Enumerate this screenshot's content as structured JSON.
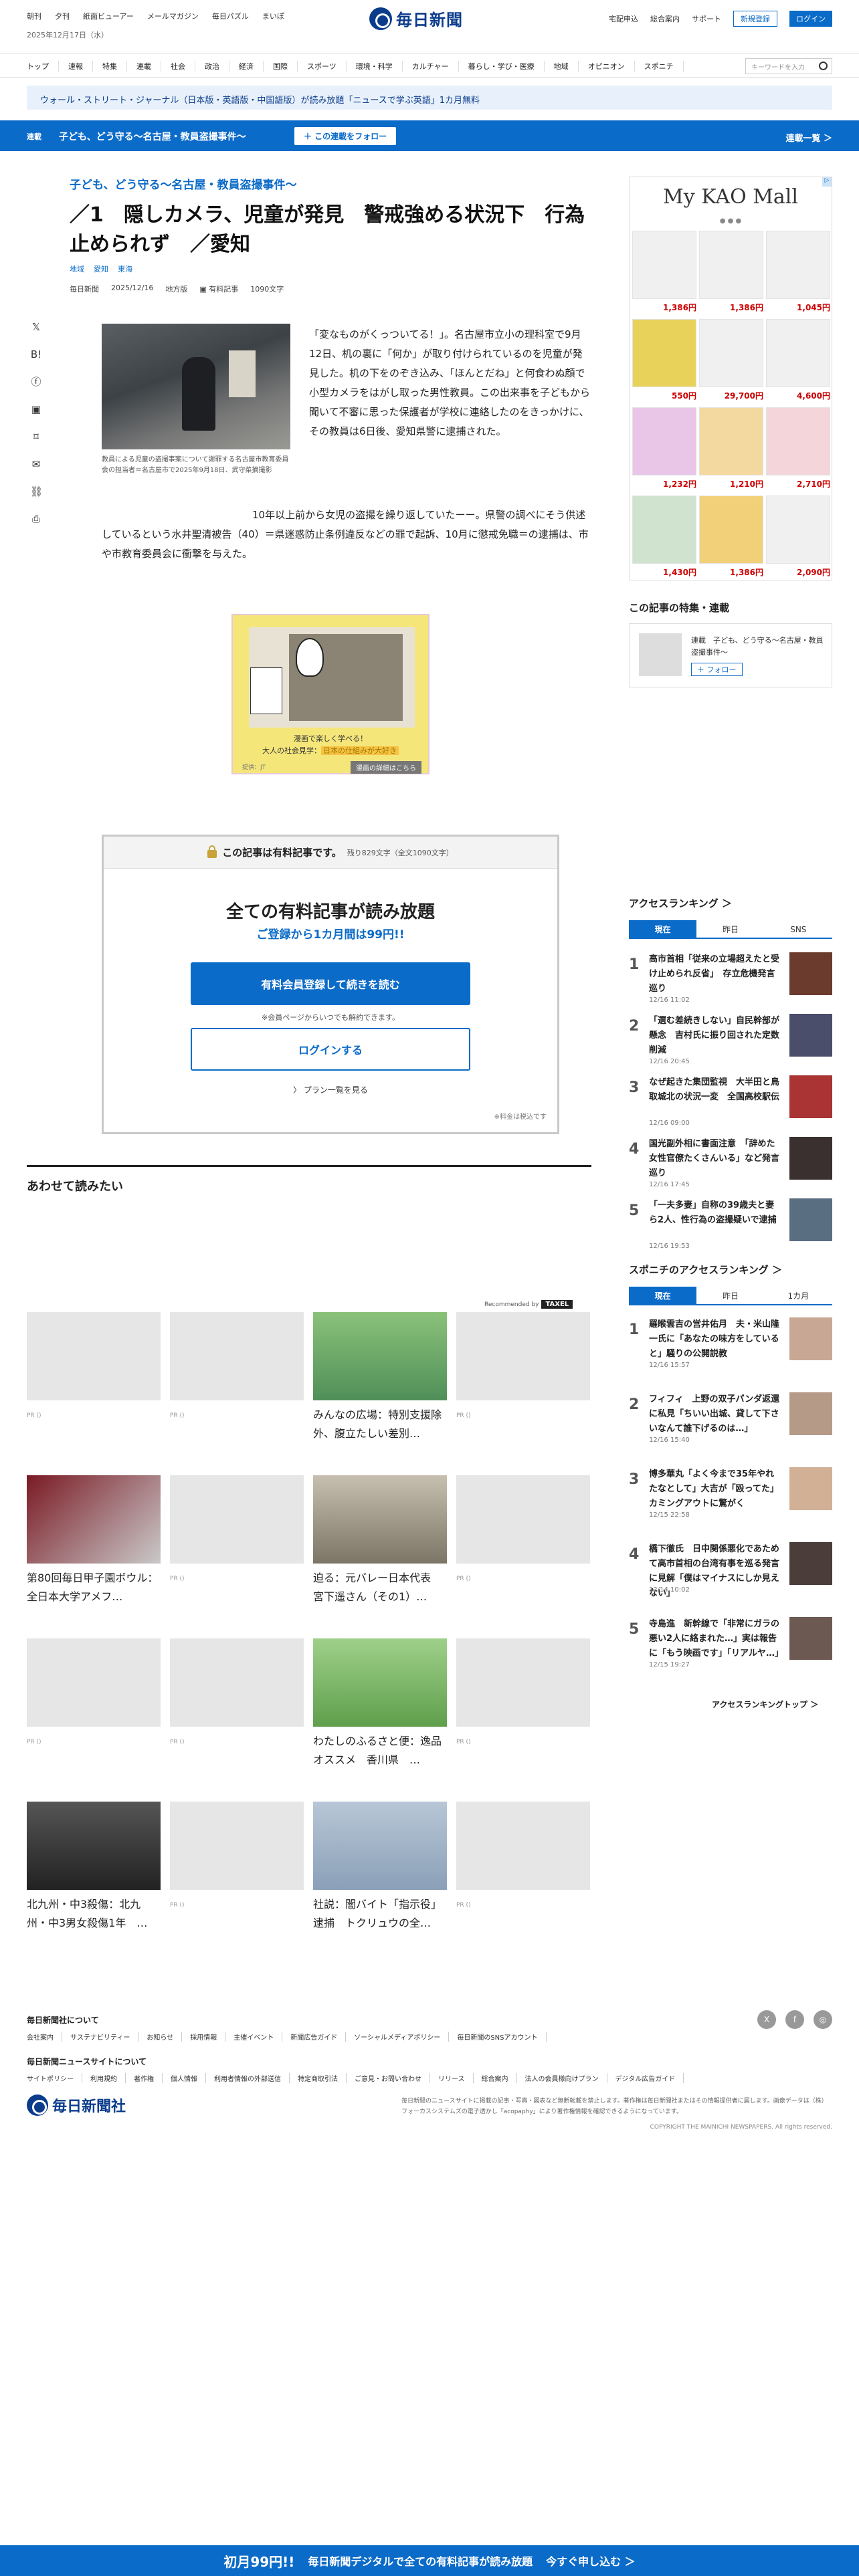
{
  "header": {
    "top_nav": [
      "朝刊",
      "夕刊",
      "紙面ビューアー",
      "メールマガジン",
      "毎日パズル",
      "まいぽ"
    ],
    "date": "2025年12月17日（水）",
    "logo": "毎日新聞",
    "links": [
      "宅配申込",
      "総合案内",
      "サポート"
    ],
    "register": "新規登録",
    "login": "ログイン"
  },
  "main_nav": [
    "トップ",
    "速報",
    "特集",
    "連載",
    "社会",
    "政治",
    "経済",
    "国際",
    "スポーツ",
    "環境・科学",
    "カルチャー",
    "暮らし・学び・医療",
    "地域",
    "オピニオン",
    "スポニチ"
  ],
  "search": {
    "placeholder": "キーワードを入力"
  },
  "promo": "ウォール・ストリート・ジャーナル（日本版・英語版・中国語版）が読み放題「ニュースで学ぶ英語」1カ月無料",
  "series_bar": {
    "label": "連載",
    "title": "子ども、どう守る～名古屋・教員盗撮事件～",
    "follow": "＋ この連載をフォロー",
    "list": "連載一覧 ＞"
  },
  "article": {
    "kicker": "子ども、どう守る～名古屋・教員盗撮事件～",
    "title": "／1　隠しカメラ、児童が発見　警戒強める状況下　行為止められず　／愛知",
    "tags": [
      "地域",
      "愛知",
      "東海"
    ],
    "meta": {
      "source": "毎日新聞",
      "date": "2025/12/16",
      "section": "地方版",
      "paid": "有料記事",
      "length": "1090文字"
    },
    "caption": "教員による児童の盗撮事案について謝罪する名古屋市教育委員会の担当者＝名古屋市で2025年9月18日、武守菜摘撮影",
    "lead": "「変なものがくっついてる！」。名古屋市立小の理科室で9月12日、机の裏に「何か」が取り付けられているのを児童が発見した。机の下をのぞき込み、「ほんとだね」と何食わぬ顔で小型カメラをはがし取った男性教員。この出来事を子どもから聞いて不審に思った保護者が学校に連絡したのをきっかけに、その教員は6日後、愛知県警に逮捕された。",
    "para2": "10年以上前から女児の盗撮を繰り返していたーー。県警の調べにそう供述しているという水井聖清被告（40）＝県迷惑防止条例違反などの罪で起訴、10月に懲戒免職＝の逮捕は、市や市教育委員会に衝撃を与えた。"
  },
  "share": [
    "x-icon",
    "hatena-icon",
    "facebook-icon",
    "note-icon",
    "bookmark-icon",
    "mail-icon",
    "link-icon",
    "print-icon"
  ],
  "ad": {
    "line1": "漫画で楽しく学べる！",
    "highlight": "日本の仕組みが大好き",
    "line2": "大人の社会見学：",
    "sponsor": "提供：JT",
    "cta": "漫画の詳細はこちら"
  },
  "paywall": {
    "head": "この記事は有料記事です。",
    "remaining": "残り829文字（全文1090文字）",
    "title": "全ての有料記事が読み放題",
    "subtitle": "ご登録から1カ月間は99円!!",
    "register": "有料会員登録して続きを読む",
    "note": "※会員ページからいつでも解約できます。",
    "login": "ログインする",
    "plans": "〉 プラン一覧を見る",
    "tax": "※料金は税込です"
  },
  "also": {
    "title": "あわせて読みたい",
    "recommended_by": "Recommended by",
    "recommended_logo": "TAXEL",
    "cards": [
      {
        "caption": "",
        "pr": "PR ()"
      },
      {
        "caption": "",
        "pr": "PR ()"
      },
      {
        "caption": "みんなの広場：特別支援除外、腹立たしい差別…",
        "pr": ""
      },
      {
        "caption": "",
        "pr": "PR ()"
      },
      {
        "caption": "第80回毎日甲子園ボウル：全日本大学アメフ…",
        "pr": ""
      },
      {
        "caption": "",
        "pr": "PR ()"
      },
      {
        "caption": "迫る：元バレー日本代表　宮下遥さん（その1）…",
        "pr": ""
      },
      {
        "caption": "",
        "pr": "PR ()"
      },
      {
        "caption": "",
        "pr": "PR ()"
      },
      {
        "caption": "",
        "pr": "PR ()"
      },
      {
        "caption": "わたしのふるさと便：逸品オススメ　香川県　…",
        "pr": ""
      },
      {
        "caption": "",
        "pr": "PR ()"
      },
      {
        "caption": "北九州・中3殺傷：北九州・中3男女殺傷1年　…",
        "pr": ""
      },
      {
        "caption": "",
        "pr": "PR ()"
      },
      {
        "caption": "社説：闇バイト「指示役」逮捕　トクリュウの全…",
        "pr": ""
      },
      {
        "caption": "",
        "pr": "PR ()"
      }
    ]
  },
  "sidebar": {
    "kao": {
      "title": "My KAO Mall",
      "prices": [
        "1,386円",
        "1,386円",
        "1,045円",
        "550円",
        "29,700円",
        "4,600円",
        "1,232円",
        "1,210円",
        "2,710円",
        "1,430円",
        "1,386円",
        "2,090円"
      ]
    },
    "feature_title": "この記事の特集・連載",
    "feature": {
      "label": "連載　子ども、どう守る～名古屋・教員盗撮事件～",
      "follow": "＋ フォロー"
    },
    "ranking_title": "アクセスランキング ＞",
    "ranking_tabs": [
      "現在",
      "昨日",
      "SNS"
    ],
    "ranking": [
      {
        "num": "1",
        "text": "高市首相「従来の立場超えたと受け止められ反省」　存立危機発言巡り",
        "time": "12/16 11:02"
      },
      {
        "num": "2",
        "text": "「選む差続きしない」自民幹部が懸念　吉村氏に振り回された定数削減",
        "time": "12/16 20:45"
      },
      {
        "num": "3",
        "text": "なぜ起きた集団監視　大半田と鳥取城北の状況一変　全国高校駅伝",
        "time": "12/16 09:00"
      },
      {
        "num": "4",
        "text": "国光副外相に書面注意　「辞めた女性官僚たくさんいる」など発言巡り",
        "time": "12/16 17:45"
      },
      {
        "num": "5",
        "text": "「一夫多妻」自称の39歳夫と妻ら2人、性行為の盗撮疑いで逮捕",
        "time": "12/16 19:53"
      }
    ],
    "sponichi_title": "スポニチのアクセスランキング ＞",
    "sponichi_tabs": [
      "現在",
      "昨日",
      "1カ月"
    ],
    "sponichi": [
      {
        "num": "1",
        "text": "羅睺雲吉の営井佑月　夫・米山隆一氏に「あなたの味方をしていると」騒りの公開説教",
        "time": "12/16 15:57"
      },
      {
        "num": "2",
        "text": "フィフィ　上野の双子パンダ返還に私見「ちいい出城、貸して下さいなんて誰下げるのは…」",
        "time": "12/16 15:40"
      },
      {
        "num": "3",
        "text": "博多華丸「よく今まで35年やれたなとして」大吉が「殴ってた」カミングアウトに驚がく",
        "time": "12/15 22:58"
      },
      {
        "num": "4",
        "text": "橋下徹氏　日中関係悪化であためて高市首相の台湾有事を巡る発言に見解「僕はマイナスにしか見えない」",
        "time": "12/14 10:02"
      },
      {
        "num": "5",
        "text": "寺島進　新幹線で「非常にガラの悪い2人に絡まれた…」実は報告に「もう映画です」「リアルヤ…」",
        "time": "12/15 19:27"
      }
    ],
    "ranking_more": "アクセスランキングトップ ＞"
  },
  "footer": {
    "about_title": "毎日新聞社について",
    "about_links": [
      "会社案内",
      "サステナビリティー",
      "お知らせ",
      "採用情報",
      "主催イベント",
      "新聞広告ガイド",
      "ソーシャルメディアポリシー",
      "毎日新聞のSNSアカウント"
    ],
    "site_title": "毎日新聞ニュースサイトについて",
    "site_links": [
      "サイトポリシー",
      "利用規約",
      "著作権",
      "個人情報",
      "利用者情報の外部送信",
      "特定商取引法",
      "ご意見・お問い合わせ",
      "リリース",
      "総合案内",
      "法人の会員様向けプラン",
      "デジタル広告ガイド"
    ],
    "social": [
      "X",
      "f",
      "◎"
    ],
    "logo": "毎日新聞社",
    "note": "毎日新聞のニュースサイトに掲載の記事・写真・図表など無断転載を禁止します。著作権は毎日新聞社またはその情報提供者に属します。画像データは（株）フォーカスシステムズの電子透かし「acopaphy」により著作権情報を確認できるようになっています。",
    "copyright": "COPYRIGHT THE MAINICHI NEWSPAPERS. All rights reserved."
  },
  "sticky": {
    "price": "初月99円!!",
    "text": "毎日新聞デジタルで全ての有料記事が読み放題",
    "cta": "今すぐ申し込む ＞"
  }
}
